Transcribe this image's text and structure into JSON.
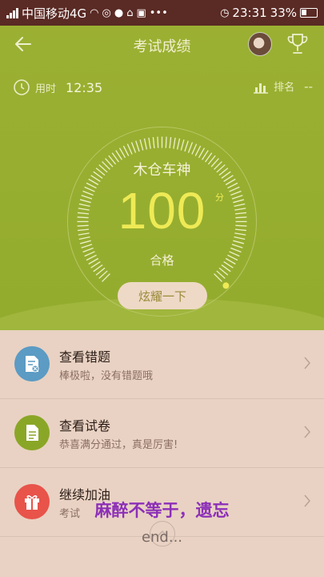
{
  "status_bar": {
    "carrier": "中国移动4G",
    "time": "23:31",
    "battery": "33%"
  },
  "header": {
    "title": "考试成绩",
    "back_icon": "back-arrow-icon",
    "trophy_icon": "trophy-icon"
  },
  "stats": {
    "time_label": "用时",
    "time_value": "12:35",
    "rank_label": "排名",
    "rank_value": "--"
  },
  "result": {
    "user_name": "木仓车神",
    "score": "100",
    "unit": "分",
    "verdict": "合格",
    "share_label": "炫耀一下",
    "progress_fraction": 1.0
  },
  "actions": [
    {
      "title": "查看错题",
      "subtitle": "棒极啦，没有错题哦",
      "icon": "wrong-questions-icon",
      "color": "#5b9bc4"
    },
    {
      "title": "查看试卷",
      "subtitle": "恭喜满分通过，真是厉害!",
      "icon": "exam-paper-icon",
      "color": "#8aa627"
    },
    {
      "title": "继续加油",
      "subtitle": "考试",
      "icon": "gift-icon",
      "color": "#e8534a"
    }
  ],
  "overlay": {
    "watermark": "麻醉不等于，遗忘",
    "end_text": "end..."
  },
  "colors": {
    "hero": "#9bb032",
    "score": "#eeea55",
    "background": "#e9d2c3"
  }
}
